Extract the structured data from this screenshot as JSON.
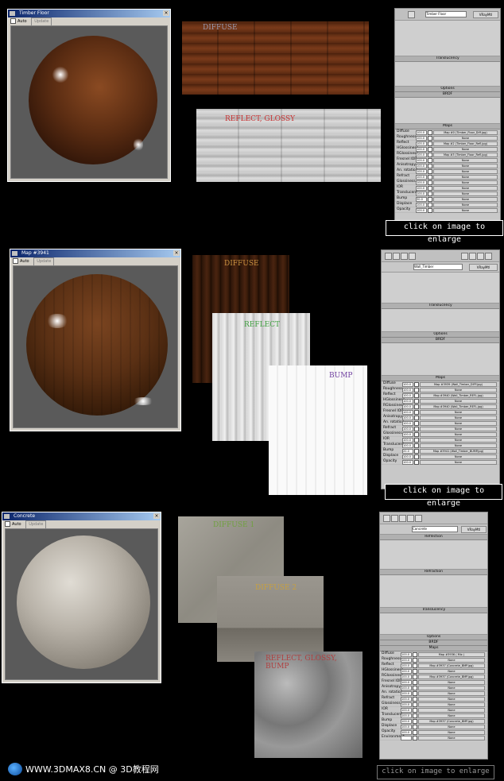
{
  "sections": [
    {
      "window_title": "Timber Floor",
      "auto_label": "Auto",
      "update_label": "Update",
      "textures": [
        {
          "label": "DIFFUSE"
        },
        {
          "label": "REFLECT, GLOSSY"
        }
      ],
      "material_name": "Timber Floor",
      "map_rows": [
        {
          "name": "Diffuse",
          "value": "100.0",
          "map": "Map #0 (Timber_Floor_Diff.jpg)"
        },
        {
          "name": "Roughness",
          "value": "100.0",
          "map": "None"
        },
        {
          "name": "Reflect",
          "value": "100.0",
          "map": "Map #2 (Timber_Floor_Refl.jpg)"
        },
        {
          "name": "HGlossiness",
          "value": "100.0",
          "map": "None"
        },
        {
          "name": "RGlossiness",
          "value": "100.0",
          "map": "Map #3 (Timber_Floor_Refl.jpg)"
        },
        {
          "name": "Fresnel IOR",
          "value": "100.0",
          "map": "None"
        },
        {
          "name": "Anisotropy",
          "value": "100.0",
          "map": "None"
        },
        {
          "name": "An. rotation",
          "value": "100.0",
          "map": "None"
        },
        {
          "name": "Refract",
          "value": "100.0",
          "map": "None"
        },
        {
          "name": "Glossiness",
          "value": "100.0",
          "map": "None"
        },
        {
          "name": "IOR",
          "value": "100.0",
          "map": "None"
        },
        {
          "name": "Translucent",
          "value": "100.0",
          "map": "None"
        },
        {
          "name": "Bump",
          "value": "30.0",
          "map": "None"
        },
        {
          "name": "Displace",
          "value": "100.0",
          "map": "None"
        },
        {
          "name": "Opacity",
          "value": "100.0",
          "map": "None"
        }
      ],
      "enlarge_label": "click on image to enlarge"
    },
    {
      "window_title": "Map #3941",
      "auto_label": "Auto",
      "update_label": "Update",
      "textures": [
        {
          "label": "DIFFUSE"
        },
        {
          "label": "REFLECT"
        },
        {
          "label": "BUMP"
        }
      ],
      "material_name": "Wall_Timber",
      "map_rows": [
        {
          "name": "Diffuse",
          "value": "100.0",
          "map": "Map #3939 (Wall_Timber_DIFF.jpg)"
        },
        {
          "name": "Roughness",
          "value": "100.0",
          "map": "None"
        },
        {
          "name": "Reflect",
          "value": "100.0",
          "map": "Map #3940 (Wall_Timber_REFL.jpg)"
        },
        {
          "name": "HGlossiness",
          "value": "100.0",
          "map": "None"
        },
        {
          "name": "RGlossiness",
          "value": "100.0",
          "map": "Map #3940 (Wall_Timber_REFL.jpg)"
        },
        {
          "name": "Fresnel IOR",
          "value": "100.0",
          "map": "None"
        },
        {
          "name": "Anisotropy",
          "value": "100.0",
          "map": "None"
        },
        {
          "name": "An. rotation",
          "value": "100.0",
          "map": "None"
        },
        {
          "name": "Refract",
          "value": "100.0",
          "map": "None"
        },
        {
          "name": "Glossiness",
          "value": "100.0",
          "map": "None"
        },
        {
          "name": "IOR",
          "value": "100.0",
          "map": "None"
        },
        {
          "name": "Translucent",
          "value": "100.0",
          "map": "None"
        },
        {
          "name": "Bump",
          "value": "20.0",
          "map": "Map #3941 (Wall_Timber_BUMP.jpg)"
        },
        {
          "name": "Displace",
          "value": "100.0",
          "map": "None"
        },
        {
          "name": "Opacity",
          "value": "100.0",
          "map": "None"
        }
      ],
      "enlarge_label": "click on image to enlarge"
    },
    {
      "window_title": "Concrete",
      "auto_label": "Auto",
      "update_label": "Update",
      "textures": [
        {
          "label": "DIFFUSE 1"
        },
        {
          "label": "DIFFUSE 2"
        },
        {
          "label": "REFLECT, GLOSSY, BUMP"
        }
      ],
      "material_name": "Concrete",
      "map_rows": [
        {
          "name": "Diffuse",
          "value": "100.0",
          "map": "Map #3936 ( Mix )"
        },
        {
          "name": "Roughness",
          "value": "100.0",
          "map": "None"
        },
        {
          "name": "Reflect",
          "value": "100.0",
          "map": "Map #3937 (Concrete_BMP.jpg)"
        },
        {
          "name": "HGlossiness",
          "value": "100.0",
          "map": "None"
        },
        {
          "name": "RGlossiness",
          "value": "100.0",
          "map": "Map #3937 (Concrete_BMP.jpg)"
        },
        {
          "name": "Fresnel IOR",
          "value": "100.0",
          "map": "None"
        },
        {
          "name": "Anisotropy",
          "value": "100.0",
          "map": "None"
        },
        {
          "name": "An. rotation",
          "value": "100.0",
          "map": "None"
        },
        {
          "name": "Refract",
          "value": "100.0",
          "map": "None"
        },
        {
          "name": "Glossiness",
          "value": "100.0",
          "map": "None"
        },
        {
          "name": "IOR",
          "value": "100.0",
          "map": "None"
        },
        {
          "name": "Translucent",
          "value": "100.0",
          "map": "None"
        },
        {
          "name": "Bump",
          "value": "100.0",
          "map": "Map #3937 (Concrete_BMP.jpg)"
        },
        {
          "name": "Displace",
          "value": "100.0",
          "map": "None"
        },
        {
          "name": "Opacity",
          "value": "100.0",
          "map": "None"
        },
        {
          "name": "Environment",
          "value": "",
          "map": "None"
        }
      ],
      "enlarge_label": "click on image to enlarge"
    }
  ],
  "footer": {
    "text": "WWW.3DMAX8.CN @ 3D教程网"
  }
}
